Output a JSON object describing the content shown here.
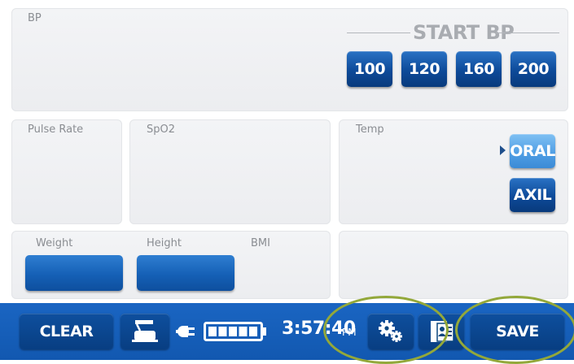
{
  "bp": {
    "label": "BP",
    "start_title": "START BP",
    "buttons": [
      "100",
      "120",
      "160",
      "200"
    ]
  },
  "pulse": {
    "label": "Pulse Rate"
  },
  "spo2": {
    "label": "SpO2"
  },
  "temp": {
    "label": "Temp",
    "oral_label": "ORAL",
    "axil_label": "AXIL",
    "selected": "ORAL"
  },
  "measures": {
    "weight_label": "Weight",
    "height_label": "Height",
    "bmi_label": "BMI"
  },
  "bottom_bar": {
    "clear_label": "CLEAR",
    "time": "3:57:40",
    "ampm": "PM",
    "save_label": "SAVE",
    "icons": [
      "scale-icon",
      "plug-icon",
      "battery-icon",
      "gears-icon",
      "patient-card-icon"
    ],
    "battery_level": 1.0
  },
  "colors": {
    "bar": "#1a65c2",
    "button": "#0d4a99",
    "active_button": "#4d9ce3",
    "annotation_circle": "#93a83a"
  }
}
